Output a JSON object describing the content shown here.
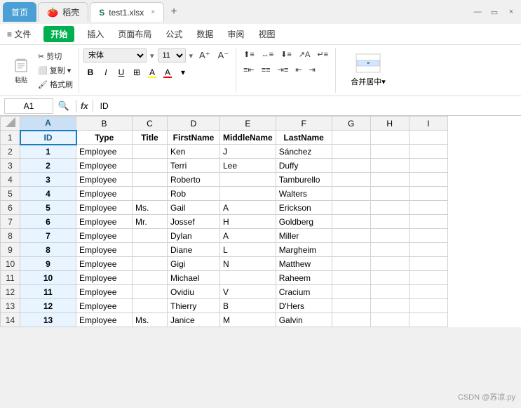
{
  "titleBar": {
    "tabs": [
      {
        "id": "home",
        "label": "首页",
        "type": "home"
      },
      {
        "id": "wps",
        "label": "稻壳",
        "type": "wps"
      },
      {
        "id": "file",
        "label": "test1.xlsx",
        "type": "active"
      }
    ],
    "addTab": "+",
    "windowControls": [
      "▭",
      "×"
    ]
  },
  "ribbon": {
    "tabs": [
      {
        "id": "file",
        "label": "≡ 文件"
      },
      {
        "id": "start",
        "label": "开始",
        "isStart": true
      },
      {
        "id": "insert",
        "label": "插入"
      },
      {
        "id": "layout",
        "label": "页面布局"
      },
      {
        "id": "formula",
        "label": "公式"
      },
      {
        "id": "data",
        "label": "数据"
      },
      {
        "id": "review",
        "label": "审阅"
      },
      {
        "id": "view",
        "label": "视图"
      }
    ],
    "toolbar": {
      "paste": "粘贴",
      "cut": "✂ 剪切",
      "copy": "⬜ 复制▾",
      "format": "🖌 格式刷",
      "fontName": "宋体",
      "fontSize": "11",
      "bold": "B",
      "italic": "I",
      "underline": "U",
      "border": "⊞",
      "fillColor": "A",
      "fontColor": "A",
      "mergeLabel": "合并居中▾",
      "alignItems": [
        "≡",
        "≡",
        "≡",
        "⇤",
        "≡",
        "⇥"
      ],
      "alignItems2": [
        "≡",
        "≡",
        "≡",
        "⇤",
        "≡",
        "↵"
      ]
    }
  },
  "formulaBar": {
    "cellRef": "A1",
    "magnify": "🔍",
    "fx": "fx",
    "value": "ID"
  },
  "columns": [
    {
      "id": "row",
      "label": ""
    },
    {
      "id": "A",
      "label": "A"
    },
    {
      "id": "B",
      "label": "B"
    },
    {
      "id": "C",
      "label": "C"
    },
    {
      "id": "D",
      "label": "D"
    },
    {
      "id": "E",
      "label": "E"
    },
    {
      "id": "F",
      "label": "F"
    },
    {
      "id": "G",
      "label": "G"
    },
    {
      "id": "H",
      "label": "H"
    },
    {
      "id": "I",
      "label": "I"
    }
  ],
  "rows": [
    {
      "num": "1",
      "A": "ID",
      "B": "Type",
      "C": "Title",
      "D": "FirstName",
      "E": "MiddleName",
      "F": "LastName",
      "G": "",
      "H": "",
      "I": "",
      "isHeader": true
    },
    {
      "num": "2",
      "A": "1",
      "B": "Employee",
      "C": "",
      "D": "Ken",
      "E": "J",
      "F": "Sánchez",
      "G": "",
      "H": "",
      "I": ""
    },
    {
      "num": "3",
      "A": "2",
      "B": "Employee",
      "C": "",
      "D": "Terri",
      "E": "Lee",
      "F": "Duffy",
      "G": "",
      "H": "",
      "I": ""
    },
    {
      "num": "4",
      "A": "3",
      "B": "Employee",
      "C": "",
      "D": "Roberto",
      "E": "",
      "F": "Tamburello",
      "G": "",
      "H": "",
      "I": ""
    },
    {
      "num": "5",
      "A": "4",
      "B": "Employee",
      "C": "",
      "D": "Rob",
      "E": "",
      "F": "Walters",
      "G": "",
      "H": "",
      "I": ""
    },
    {
      "num": "6",
      "A": "5",
      "B": "Employee",
      "C": "Ms.",
      "D": "Gail",
      "E": "A",
      "F": "Erickson",
      "G": "",
      "H": "",
      "I": ""
    },
    {
      "num": "7",
      "A": "6",
      "B": "Employee",
      "C": "Mr.",
      "D": "Jossef",
      "E": "H",
      "F": "Goldberg",
      "G": "",
      "H": "",
      "I": ""
    },
    {
      "num": "8",
      "A": "7",
      "B": "Employee",
      "C": "",
      "D": "Dylan",
      "E": "A",
      "F": "Miller",
      "G": "",
      "H": "",
      "I": ""
    },
    {
      "num": "9",
      "A": "8",
      "B": "Employee",
      "C": "",
      "D": "Diane",
      "E": "L",
      "F": "Margheim",
      "G": "",
      "H": "",
      "I": ""
    },
    {
      "num": "10",
      "A": "9",
      "B": "Employee",
      "C": "",
      "D": "Gigi",
      "E": "N",
      "F": "Matthew",
      "G": "",
      "H": "",
      "I": ""
    },
    {
      "num": "11",
      "A": "10",
      "B": "Employee",
      "C": "",
      "D": "Michael",
      "E": "",
      "F": "Raheem",
      "G": "",
      "H": "",
      "I": ""
    },
    {
      "num": "12",
      "A": "11",
      "B": "Employee",
      "C": "",
      "D": "Ovidiu",
      "E": "V",
      "F": "Cracium",
      "G": "",
      "H": "",
      "I": ""
    },
    {
      "num": "13",
      "A": "12",
      "B": "Employee",
      "C": "",
      "D": "Thierry",
      "E": "B",
      "F": "D'Hers",
      "G": "",
      "H": "",
      "I": ""
    },
    {
      "num": "14",
      "A": "13",
      "B": "Employee",
      "C": "Ms.",
      "D": "Janice",
      "E": "M",
      "F": "Galvin",
      "G": "",
      "H": "",
      "I": ""
    }
  ],
  "watermark": "CSDN @苏凉.py"
}
